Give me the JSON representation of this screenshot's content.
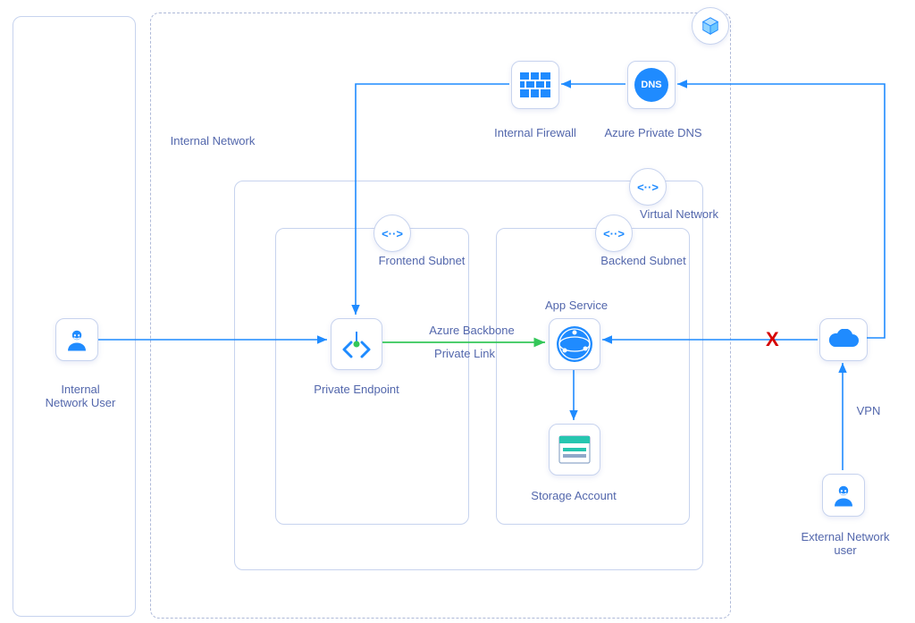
{
  "type": "azure-architecture-diagram",
  "title": "Azure Private Endpoint / Private Link architecture",
  "labels": {
    "internal_network": "Internal Network",
    "internal_user": "Internal\nNetwork User",
    "external_user": "External Network\nuser",
    "internal_firewall": "Internal Firewall",
    "azure_private_dns": "Azure Private DNS",
    "virtual_network": "Virtual Network",
    "frontend_subnet": "Frontend Subnet",
    "backend_subnet": "Backend Subnet",
    "private_endpoint": "Private Endpoint",
    "app_service": "App Service",
    "storage_account": "Storage Account",
    "azure_backbone": "Azure Backbone",
    "private_link": "Private Link",
    "vpn": "VPN"
  },
  "icons": {
    "cube": "cube-icon",
    "user": "person-icon",
    "firewall": "firewall-icon",
    "dns": "dns-icon",
    "vnet": "vnet-brackets-icon",
    "private_endpoint": "private-endpoint-icon",
    "app_service": "app-service-icon",
    "storage": "storage-account-icon",
    "cloud": "cloud-icon"
  },
  "connections": [
    {
      "from": "internal-user",
      "to": "private-endpoint",
      "color": "blue",
      "via": "direct"
    },
    {
      "from": "private-endpoint",
      "to": "app-service",
      "color": "green",
      "label": "Azure Backbone / Private Link"
    },
    {
      "from": "app-service",
      "to": "storage-account",
      "color": "blue"
    },
    {
      "from": "cloud-internet",
      "to": "app-service",
      "color": "blue",
      "blocked": true
    },
    {
      "from": "external-user",
      "to": "cloud-internet",
      "color": "blue",
      "label": "VPN"
    },
    {
      "from": "cloud-internet",
      "to": "azure-private-dns",
      "color": "blue"
    },
    {
      "from": "azure-private-dns",
      "to": "internal-firewall",
      "color": "blue"
    },
    {
      "from": "internal-firewall",
      "to": "private-endpoint",
      "color": "blue"
    }
  ],
  "blocked_marker": "X",
  "colors": {
    "azure_blue": "#1f8bff",
    "link_green": "#34c759",
    "border": "#c7d3ee",
    "text": "#5367ac",
    "blocked": "#d60000"
  }
}
